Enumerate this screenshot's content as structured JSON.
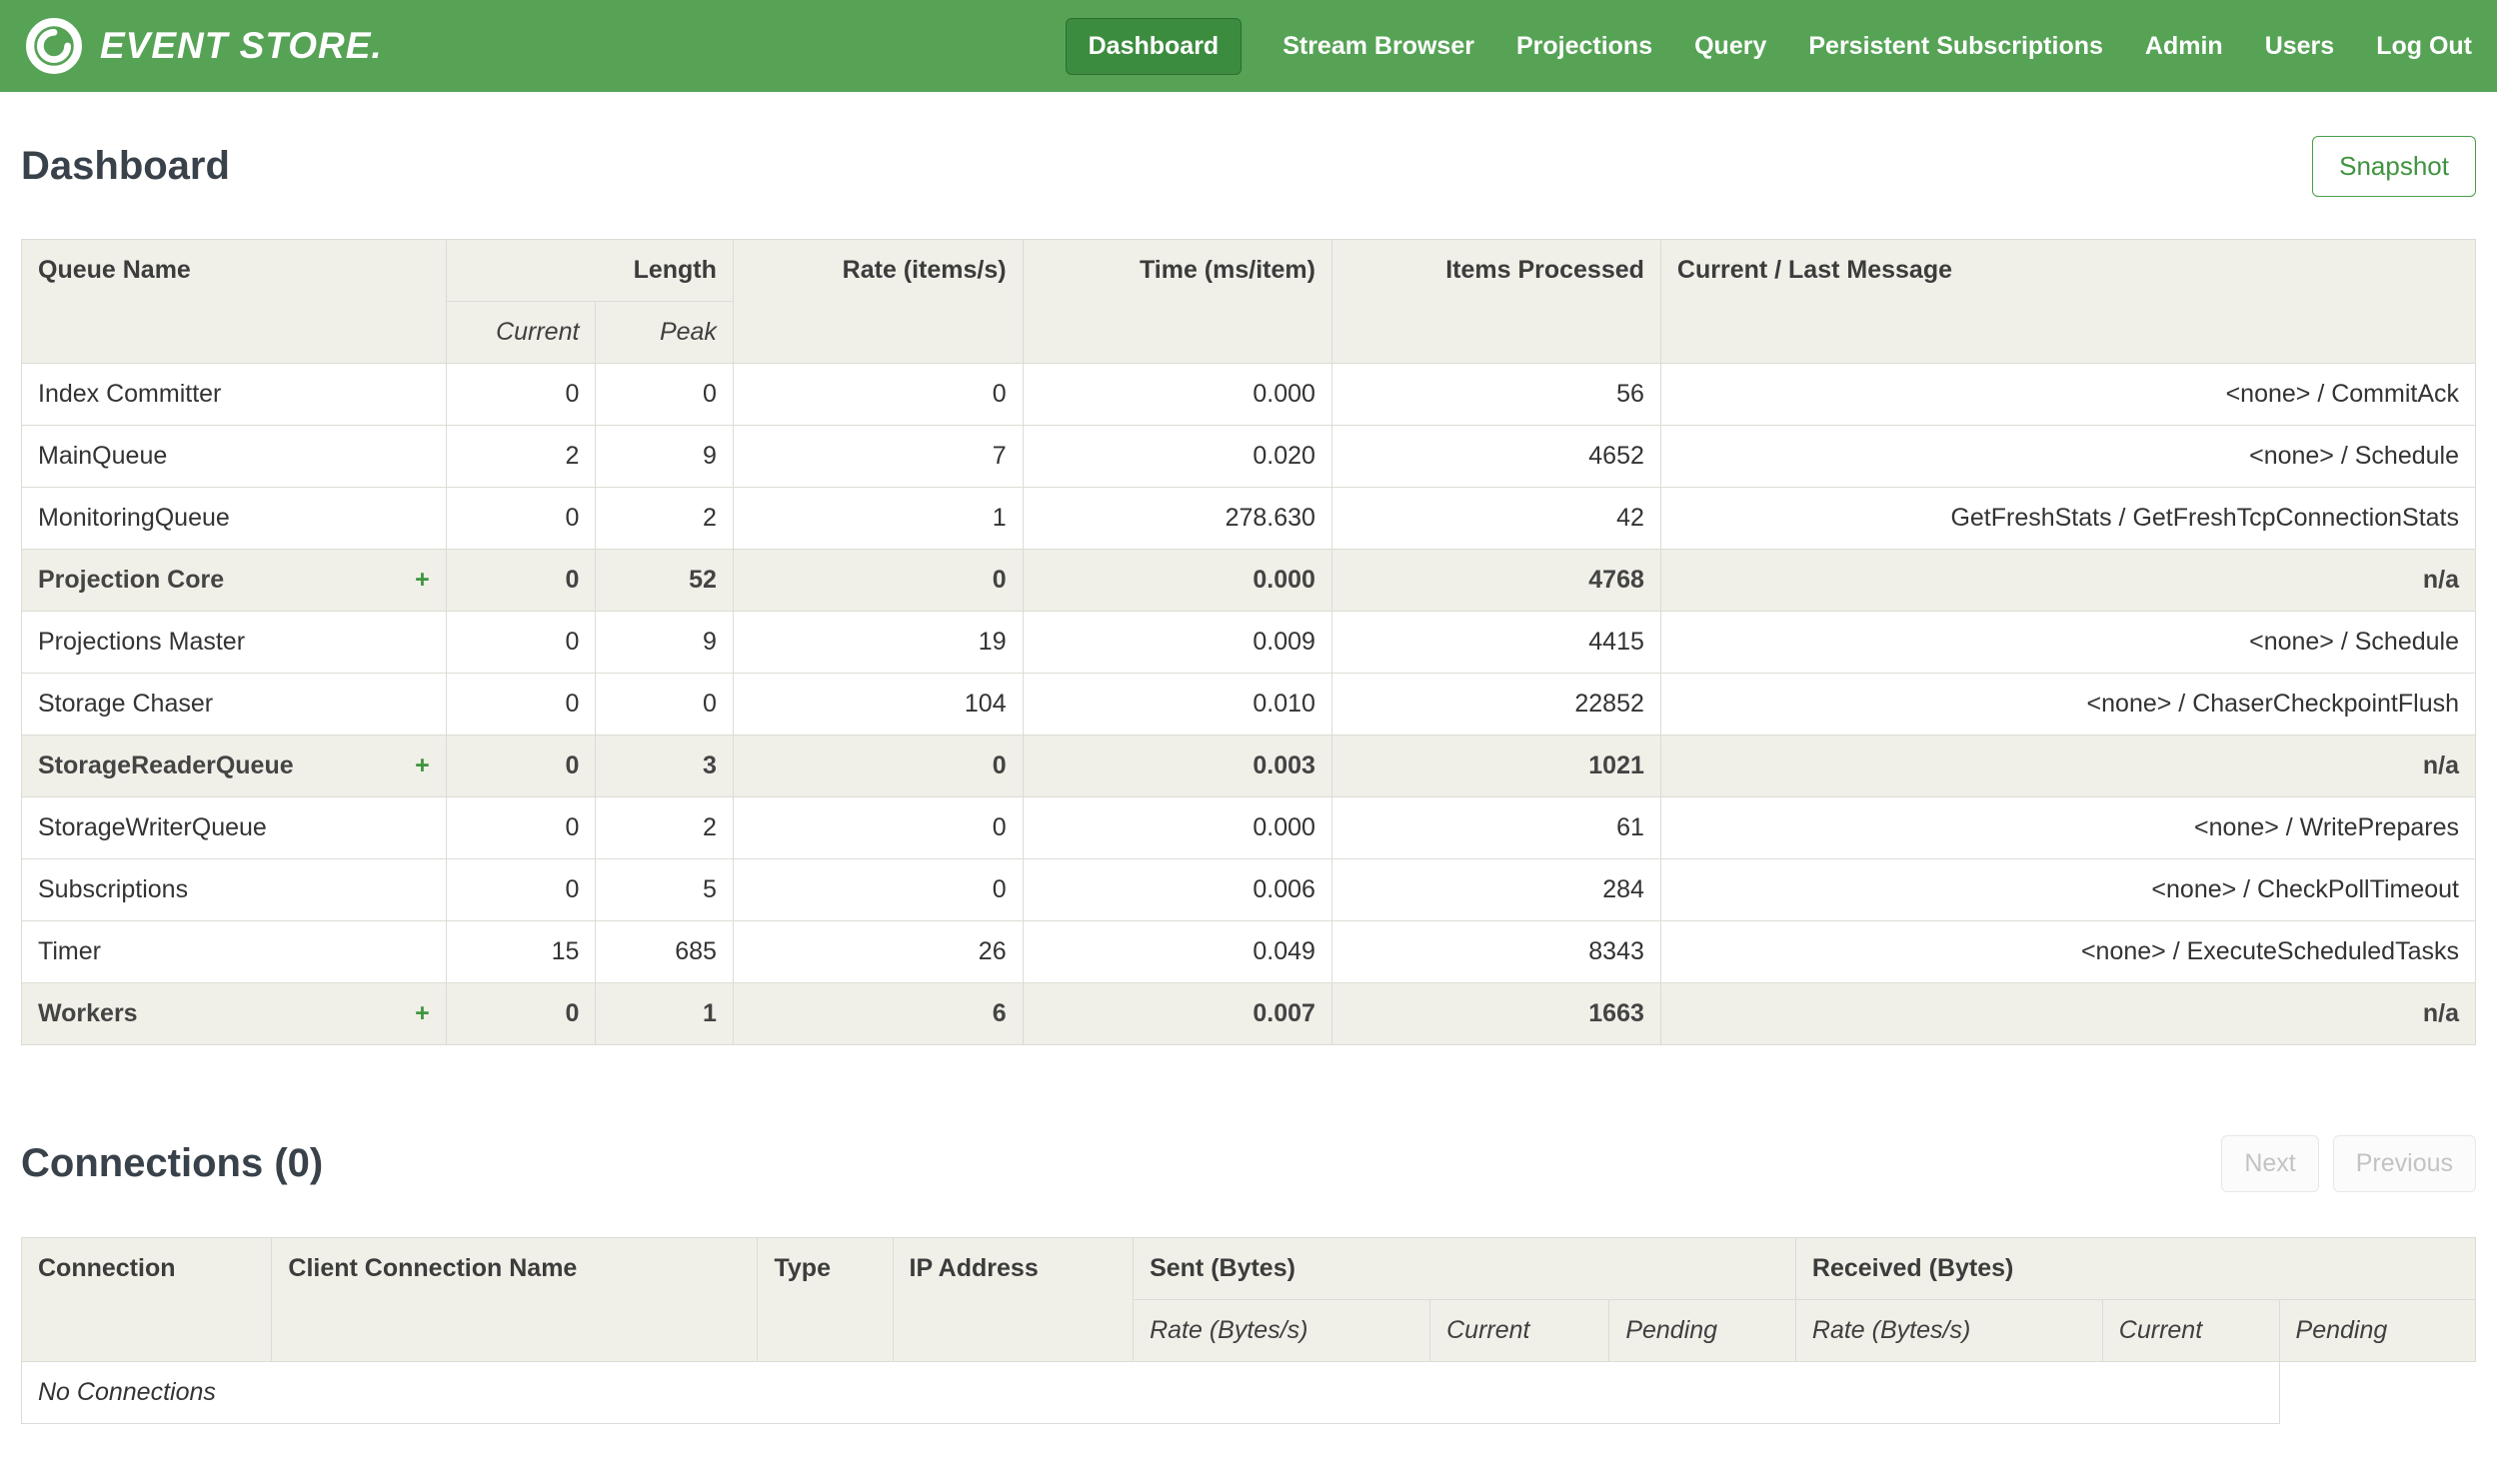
{
  "colors": {
    "navbar_green": "#56a356",
    "active_nav_green": "#3c8c3f",
    "accent_green": "#3f943f",
    "header_bg": "#f0efe8",
    "border": "#dcdcd6"
  },
  "nav": {
    "brand": "EVENT STORE.",
    "items": [
      {
        "label": "Dashboard",
        "active": true
      },
      {
        "label": "Stream Browser",
        "active": false
      },
      {
        "label": "Projections",
        "active": false
      },
      {
        "label": "Query",
        "active": false
      },
      {
        "label": "Persistent Subscriptions",
        "active": false
      },
      {
        "label": "Admin",
        "active": false
      },
      {
        "label": "Users",
        "active": false
      },
      {
        "label": "Log Out",
        "active": false
      }
    ]
  },
  "dashboard": {
    "title": "Dashboard",
    "snapshot_label": "Snapshot"
  },
  "queues_table": {
    "expand_icon": "+",
    "headers": {
      "queue_name": "Queue Name",
      "length": "Length",
      "current": "Current",
      "peak": "Peak",
      "rate": "Rate (items/s)",
      "time": "Time (ms/item)",
      "items": "Items Processed",
      "message": "Current / Last Message"
    },
    "rows": [
      {
        "name": "Index Committer",
        "group": false,
        "current": "0",
        "peak": "0",
        "rate": "0",
        "time": "0.000",
        "items": "56",
        "message": "<none> / CommitAck"
      },
      {
        "name": "MainQueue",
        "group": false,
        "current": "2",
        "peak": "9",
        "rate": "7",
        "time": "0.020",
        "items": "4652",
        "message": "<none> / Schedule"
      },
      {
        "name": "MonitoringQueue",
        "group": false,
        "current": "0",
        "peak": "2",
        "rate": "1",
        "time": "278.630",
        "items": "42",
        "message": "GetFreshStats / GetFreshTcpConnectionStats"
      },
      {
        "name": "Projection Core",
        "group": true,
        "current": "0",
        "peak": "52",
        "rate": "0",
        "time": "0.000",
        "items": "4768",
        "message": "n/a"
      },
      {
        "name": "Projections Master",
        "group": false,
        "current": "0",
        "peak": "9",
        "rate": "19",
        "time": "0.009",
        "items": "4415",
        "message": "<none> / Schedule"
      },
      {
        "name": "Storage Chaser",
        "group": false,
        "current": "0",
        "peak": "0",
        "rate": "104",
        "time": "0.010",
        "items": "22852",
        "message": "<none> / ChaserCheckpointFlush"
      },
      {
        "name": "StorageReaderQueue",
        "group": true,
        "current": "0",
        "peak": "3",
        "rate": "0",
        "time": "0.003",
        "items": "1021",
        "message": "n/a"
      },
      {
        "name": "StorageWriterQueue",
        "group": false,
        "current": "0",
        "peak": "2",
        "rate": "0",
        "time": "0.000",
        "items": "61",
        "message": "<none> / WritePrepares"
      },
      {
        "name": "Subscriptions",
        "group": false,
        "current": "0",
        "peak": "5",
        "rate": "0",
        "time": "0.006",
        "items": "284",
        "message": "<none> / CheckPollTimeout"
      },
      {
        "name": "Timer",
        "group": false,
        "current": "15",
        "peak": "685",
        "rate": "26",
        "time": "0.049",
        "items": "8343",
        "message": "<none> / ExecuteScheduledTasks"
      },
      {
        "name": "Workers",
        "group": true,
        "current": "0",
        "peak": "1",
        "rate": "6",
        "time": "0.007",
        "items": "1663",
        "message": "n/a"
      }
    ]
  },
  "connections": {
    "title": "Connections (0)",
    "pager": {
      "next": "Next",
      "previous": "Previous"
    },
    "headers": {
      "connection": "Connection",
      "client_name": "Client Connection Name",
      "type": "Type",
      "ip": "IP Address",
      "sent_group": "Sent (Bytes)",
      "received_group": "Received (Bytes)",
      "rate": "Rate (Bytes/s)",
      "current": "Current",
      "pending": "Pending"
    },
    "empty_text": "No Connections"
  }
}
